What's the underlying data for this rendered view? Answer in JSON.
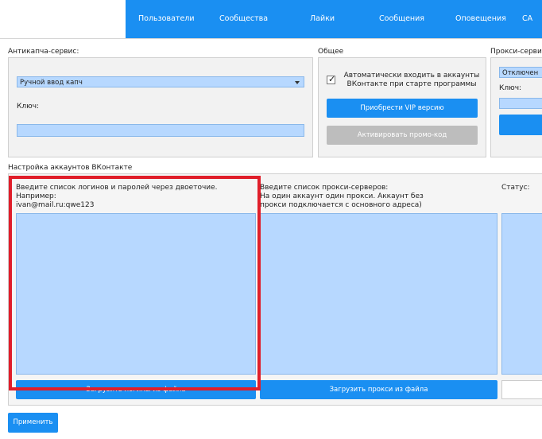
{
  "nav": {
    "items": [
      "Пользователи",
      "Сообщества",
      "Лайки",
      "Сообщения",
      "Оповещения",
      "CA"
    ]
  },
  "anticaptcha": {
    "title": "Антикапча-сервис:",
    "selected": "Ручной ввод капч",
    "key_label": "Ключ:"
  },
  "general": {
    "title": "Общее",
    "auto_login_label": "Автоматически входить в аккаунты ВКонтакте при старте программы",
    "buy_vip": "Приобрести VIP версию",
    "activate_promo": "Активировать промо-код"
  },
  "proxy_service": {
    "title": "Прокси-сервис",
    "selected": "Отключен",
    "key_label": "Ключ:"
  },
  "accounts": {
    "title": "Настройка аккаунтов ВКонтакте",
    "logins_hint_1": "Введите список логинов и паролей через двоеточие.",
    "logins_hint_2": "Например:",
    "logins_hint_3": "ivan@mail.ru:qwe123",
    "load_logins": "Загрузить логины из файла",
    "proxy_hint_1": "Введите список прокси-серверов:",
    "proxy_hint_2": "На один аккаунт один прокси. Аккаунт без",
    "proxy_hint_3": "прокси подключается с основного адреса)",
    "load_proxy": "Загрузить прокси из файла",
    "status_label": "Статус:"
  },
  "apply": "Применить",
  "colors": {
    "accent": "#1a8ff2",
    "field": "#b7d8ff",
    "highlight": "#e01e2a"
  }
}
